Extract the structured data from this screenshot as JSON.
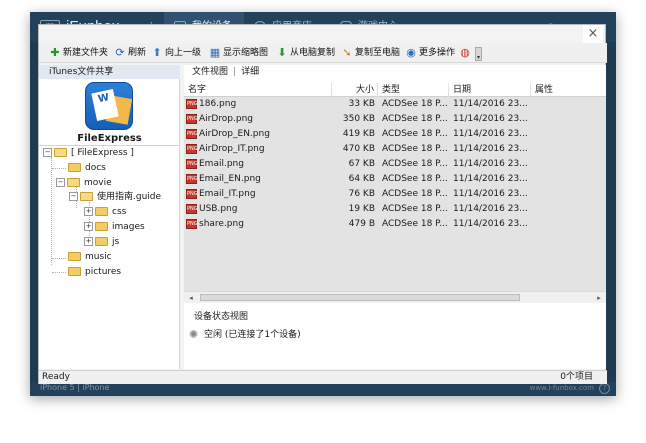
{
  "app": {
    "logo_text": "iFB",
    "name": "iFunbox",
    "nav_tabs": [
      {
        "label": "我的设备",
        "active": true
      },
      {
        "label": "应用商店",
        "active": false
      },
      {
        "label": "游戏中心",
        "active": false
      }
    ],
    "device_name": "iPhone 5 | iPhone",
    "site": "www.i-funbox.com",
    "help_label": "?"
  },
  "dialog": {
    "close_label": "×",
    "toolbar": [
      {
        "label": "新建文件夹",
        "icon": "plus-icon",
        "color": "#1c9a2b",
        "glyph": "✚"
      },
      {
        "label": "刷新",
        "icon": "refresh-icon",
        "color": "#2a63c9",
        "glyph": "⟳"
      },
      {
        "label": "向上一级",
        "icon": "up-icon",
        "color": "#3a78c2",
        "glyph": "⬆"
      },
      {
        "label": "显示缩略图",
        "icon": "thumbnail-icon",
        "color": "#2f6db5",
        "glyph": "▦"
      },
      {
        "label": "从电脑复制",
        "icon": "copy-from-pc-icon",
        "color": "#1f9a34",
        "glyph": "⬇"
      },
      {
        "label": "复制至电脑",
        "icon": "copy-to-pc-icon",
        "color": "#d07a12",
        "glyph": "➘"
      },
      {
        "label": "更多操作",
        "icon": "more-actions-icon",
        "color": "#2d6fc0",
        "glyph": "◉"
      },
      {
        "label": "",
        "icon": "weibo-icon",
        "color": "#d3322a",
        "glyph": "◍"
      }
    ],
    "overflow_label": "▾",
    "left": {
      "header": "iTunes文件共享",
      "app_name": "FileExpress",
      "app_icon_letter": "W",
      "tree": [
        {
          "label": "[ FileExpress ]",
          "level": 0,
          "expander": "−",
          "open": true
        },
        {
          "label": "docs",
          "level": 1,
          "expander": "",
          "open": false
        },
        {
          "label": "movie",
          "level": 1,
          "expander": "−",
          "open": true
        },
        {
          "label": "使用指南.guide",
          "level": 2,
          "expander": "−",
          "open": true
        },
        {
          "label": "css",
          "level": 3,
          "expander": "+",
          "open": false
        },
        {
          "label": "images",
          "level": 3,
          "expander": "+",
          "open": false
        },
        {
          "label": "js",
          "level": 3,
          "expander": "+",
          "open": false
        },
        {
          "label": "music",
          "level": 1,
          "expander": "",
          "open": false
        },
        {
          "label": "pictures",
          "level": 1,
          "expander": "",
          "open": false
        }
      ]
    },
    "right": {
      "view_file": "文件视图",
      "view_sep": "|",
      "view_detail": "详细",
      "columns": {
        "name": "名字",
        "size": "大小",
        "type": "类型",
        "date": "日期",
        "attr": "属性"
      },
      "icon_text": "PNG",
      "files": [
        {
          "name": "186.png",
          "size": "33 KB",
          "type": "ACDSee 18 P...",
          "date": "11/14/2016 23..."
        },
        {
          "name": "AirDrop.png",
          "size": "350 KB",
          "type": "ACDSee 18 P...",
          "date": "11/14/2016 23..."
        },
        {
          "name": "AirDrop_EN.png",
          "size": "419 KB",
          "type": "ACDSee 18 P...",
          "date": "11/14/2016 23..."
        },
        {
          "name": "AirDrop_IT.png",
          "size": "470 KB",
          "type": "ACDSee 18 P...",
          "date": "11/14/2016 23..."
        },
        {
          "name": "Email.png",
          "size": "67 KB",
          "type": "ACDSee 18 P...",
          "date": "11/14/2016 23..."
        },
        {
          "name": "Email_EN.png",
          "size": "64 KB",
          "type": "ACDSee 18 P...",
          "date": "11/14/2016 23..."
        },
        {
          "name": "Email_IT.png",
          "size": "76 KB",
          "type": "ACDSee 18 P...",
          "date": "11/14/2016 23..."
        },
        {
          "name": "USB.png",
          "size": "19 KB",
          "type": "ACDSee 18 P...",
          "date": "11/14/2016 23..."
        },
        {
          "name": "share.png",
          "size": "479 B",
          "type": "ACDSee 18 P...",
          "date": "11/14/2016 23..."
        }
      ],
      "scroll_left": "◂",
      "scroll_right": "▸",
      "device_status_title": "设备状态视图",
      "device_status": "空闲 (已连接了1个设备)"
    },
    "status": {
      "left": "Ready",
      "right": "0个项目"
    }
  }
}
